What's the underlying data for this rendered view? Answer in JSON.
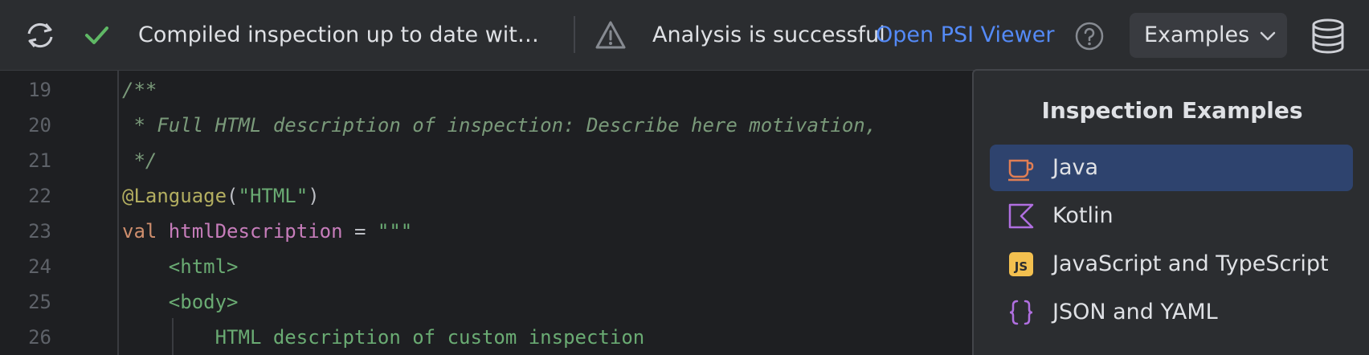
{
  "toolbar": {
    "compile_status": "Compiled inspection up to date with s...",
    "analysis_status": "Analysis is successful",
    "psi_viewer_link": "Open PSI Viewer",
    "examples_label": "Examples"
  },
  "editor": {
    "lines": [
      {
        "number": "19",
        "tokens": [
          {
            "t": "/**",
            "c": "comment"
          }
        ]
      },
      {
        "number": "20",
        "tokens": [
          {
            "t": " * Full HTML description of inspection: Describe here motivation,",
            "c": "comment"
          }
        ]
      },
      {
        "number": "21",
        "tokens": [
          {
            "t": " */",
            "c": "comment"
          }
        ]
      },
      {
        "number": "22",
        "tokens": [
          {
            "t": "@Language",
            "c": "anno"
          },
          {
            "t": "(",
            "c": "plain"
          },
          {
            "t": "\"HTML\"",
            "c": "str"
          },
          {
            "t": ")",
            "c": "plain"
          }
        ]
      },
      {
        "number": "23",
        "tokens": [
          {
            "t": "val ",
            "c": "kw"
          },
          {
            "t": "htmlDescription",
            "c": "var"
          },
          {
            "t": " = ",
            "c": "plain"
          },
          {
            "t": "\"\"\"",
            "c": "str"
          }
        ]
      },
      {
        "number": "24",
        "tokens": [
          {
            "t": "    <html>",
            "c": "str"
          }
        ]
      },
      {
        "number": "25",
        "tokens": [
          {
            "t": "    <body>",
            "c": "str"
          }
        ]
      },
      {
        "number": "26",
        "tokens": [
          {
            "t": "        HTML description of custom inspection",
            "c": "str"
          }
        ]
      }
    ]
  },
  "examples_popup": {
    "title": "Inspection Examples",
    "items": [
      {
        "label": "Java",
        "icon": "java-cup-icon",
        "selected": true
      },
      {
        "label": "Kotlin",
        "icon": "kotlin-icon",
        "selected": false
      },
      {
        "label": "JavaScript and TypeScript",
        "icon": "js-icon",
        "selected": false
      },
      {
        "label": "JSON and YAML",
        "icon": "json-braces-icon",
        "selected": false
      }
    ]
  },
  "colors": {
    "background": "#1e1f22",
    "toolbar": "#2b2d30",
    "link": "#548af7",
    "success": "#5fb865",
    "selection": "#2e436e"
  }
}
